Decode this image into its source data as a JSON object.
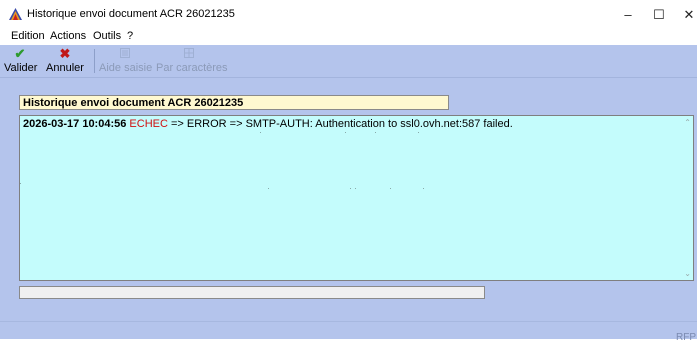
{
  "window": {
    "title": "Historique envoi document ACR 26021235",
    "minimize_icon": "minimize-icon",
    "maximize_icon": "maximize-icon",
    "close_icon": "close-icon"
  },
  "menu": {
    "items": [
      "Edition",
      "Actions",
      "Outils",
      "?"
    ]
  },
  "toolbar": {
    "valider_label": "Valider",
    "annuler_label": "Annuler",
    "aide_saisie_label": "Aide saisie",
    "par_caracteres_label": "Par caractères",
    "valider_icon": "check-icon",
    "annuler_icon": "cross-icon"
  },
  "history": {
    "title": "Historique envoi document ACR 26021235",
    "entries": [
      {
        "timestamp": "2026-03-17 10:04:56",
        "status": "ECHEC",
        "message": "=> ERROR => SMTP-AUTH: Authentication to ssl0.ovh.net:587 failed."
      }
    ]
  },
  "status_field": {
    "value": ""
  },
  "corner_text": "RFP",
  "colors": {
    "background": "#b4c4ec",
    "log_background": "#c4fcfc",
    "title_background": "#fff9d0",
    "error_text": "#d01010",
    "accept_green": "#2e9a2e",
    "cancel_red": "#c01818"
  }
}
